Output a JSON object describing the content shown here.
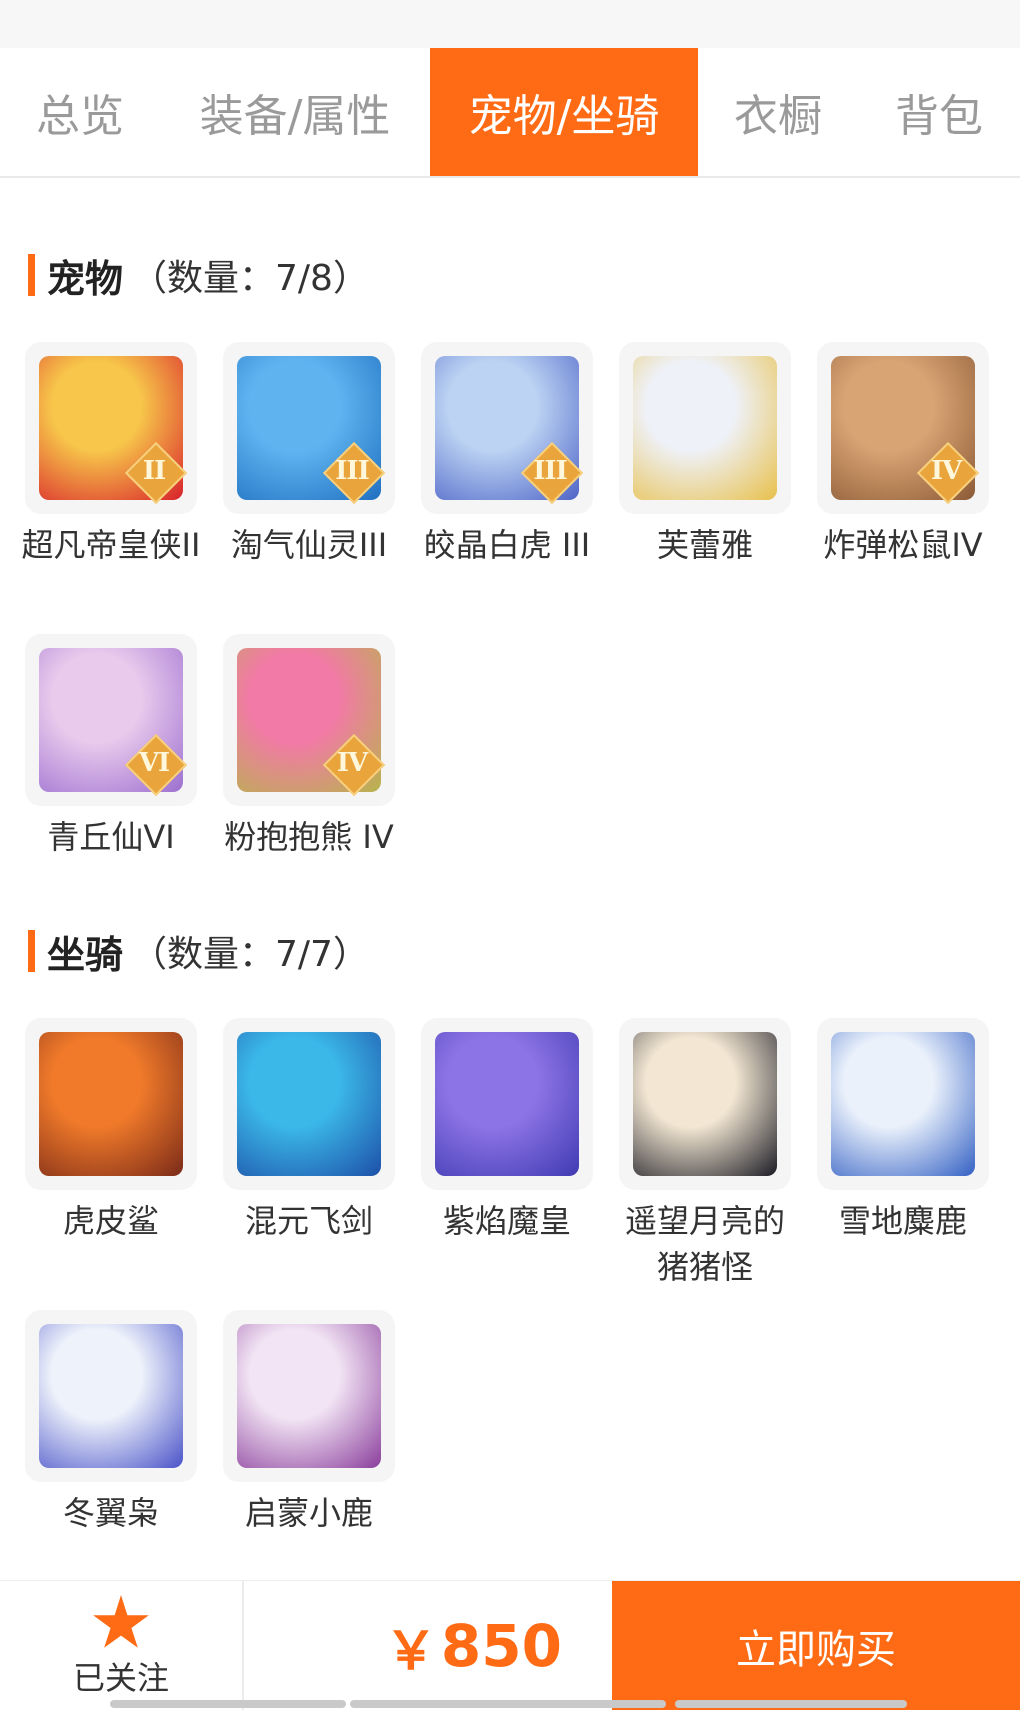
{
  "tabs": [
    {
      "label": "总览",
      "active": false
    },
    {
      "label": "装备/属性",
      "active": false
    },
    {
      "label": "宠物/坐骑",
      "active": true
    },
    {
      "label": "衣橱",
      "active": false
    },
    {
      "label": "背包",
      "active": false
    }
  ],
  "pets": {
    "title": "宠物",
    "count": "（数量：7/8）",
    "items": [
      {
        "name": "超凡帝皇侠II",
        "badge": "II",
        "icon": "golden-armored-knight-icon",
        "color_a": "#f7c64a",
        "color_b": "#d8202b"
      },
      {
        "name": "淘气仙灵III",
        "badge": "III",
        "icon": "blue-puppy-icon",
        "color_a": "#5fb4f0",
        "color_b": "#1f6fc0"
      },
      {
        "name": "皎晶白虎 III",
        "badge": "III",
        "icon": "white-tiger-icon",
        "color_a": "#bcd3f3",
        "color_b": "#4d63c7"
      },
      {
        "name": "芙蕾雅",
        "badge": "",
        "icon": "winged-goddess-icon",
        "color_a": "#eef1f8",
        "color_b": "#e8c04a"
      },
      {
        "name": "炸弹松鼠IV",
        "badge": "IV",
        "icon": "squirrel-icon",
        "color_a": "#d9a474",
        "color_b": "#8b5a36"
      },
      {
        "name": "青丘仙VI",
        "badge": "VI",
        "icon": "fox-fairy-icon",
        "color_a": "#e9c9ec",
        "color_b": "#9b6fd0"
      },
      {
        "name": "粉抱抱熊 IV",
        "badge": "IV",
        "icon": "pink-bear-icon",
        "color_a": "#f27aa6",
        "color_b": "#b6b44b"
      }
    ]
  },
  "mounts": {
    "title": "坐骑",
    "count": "（数量：7/7）",
    "items": [
      {
        "name": "虎皮鲨",
        "icon": "tiger-shark-icon",
        "color_a": "#f07a2a",
        "color_b": "#7a2a18"
      },
      {
        "name": "混元飞剑",
        "icon": "flying-sword-icon",
        "color_a": "#3bb8e8",
        "color_b": "#1d4fa8"
      },
      {
        "name": "紫焰魔皇",
        "icon": "purple-phoenix-icon",
        "color_a": "#8d74e6",
        "color_b": "#3f3ab2"
      },
      {
        "name": "遥望月亮的猪猪怪",
        "icon": "black-pig-icon",
        "color_a": "#f3e7d3",
        "color_b": "#1b1b24"
      },
      {
        "name": "雪地麋鹿",
        "icon": "snow-deer-icon",
        "color_a": "#eaf1fb",
        "color_b": "#3360c4"
      },
      {
        "name": "冬翼枭",
        "icon": "winter-owl-icon",
        "color_a": "#eef3fb",
        "color_b": "#4a52c8"
      },
      {
        "name": "启蒙小鹿",
        "icon": "fawn-icon",
        "color_a": "#f2e4f4",
        "color_b": "#8a3e9c"
      }
    ]
  },
  "footer": {
    "follow_label": "已关注",
    "star_icon": "star-icon",
    "currency": "￥",
    "price": "850",
    "buy_label": "立即购买",
    "accent": "#ff6a14"
  }
}
